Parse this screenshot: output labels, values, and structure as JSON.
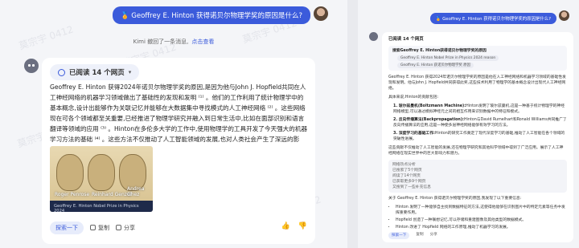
{
  "watermark": "莫宗宇 0412",
  "left": {
    "user_message": "🏅 Geoffrey E. Hinton 获得诺贝尔物理学奖的原因是什么?",
    "cancel_note": "Kimi 撤回了一条消息,",
    "cancel_link": "点击查看",
    "read_chip": "已阅读 14 个网页",
    "answer": "Geoffrey E. Hinton 获得2024年诺贝尔物理学奖的原因,是因为他与John J. Hopfield共同在人工神经网络的机器学习领域做出了基础性的发现和发明 ⁽¹⁾ 。他们的工作利用了统计物理学中的基本概念,设计出能够作为关联记忆并能够在大数据集中寻找模式的人工神经网络 ⁽²⁾ 。这些网络现在可各个领域都至关重要,已经推进了物理学研究并融入到日常生活中,比如在面部识别和语言翻译等领域的应用 ⁽³⁾ 。Hinton在多伦多大学的工作中,使用物理学的工具开发了今天强大的机器学习方法的基础 ⁽⁴⁾ 。这些方法不仅推动了人工智能领域的发展,也对人类社会产生了深远的影响。",
    "photo_names": [
      "Roger Penrose",
      "Reinhard Genzel",
      "Andrea Ghez"
    ],
    "photo_caption": "Geoffrey E. Hinton Nobel Prize in Physics 2024",
    "actions": {
      "search_more": "探索一下",
      "copy": "复制",
      "share": "分享"
    }
  },
  "right": {
    "user_message": "🏅 Geoffrey E. Hinton 获得诺贝尔物理学奖的原因是什么?",
    "read_title": "已阅读 14 个网页",
    "search_query": "搜索Geoffrey E. Hinton获得诺贝尔物理学奖的原因",
    "search_tags": [
      "Geoffrey E. Hinton Nobel Prize in Physics 2024 reason",
      "Geoffrey E. Hinton 获诺贝尔物理学奖 原因"
    ],
    "intro": "Geoffrey E. Hinton 获得2024年诺贝尔物理学奖的原因是他在人工神经网络和机器学习领域的基础性发现和发明。他与John J. Hopfield共同获得此奖,这些技术利用了物理学的基本概念设计出现代人工神经网络。",
    "contributions_title": "具体来说,Hinton的贡献包括:",
    "contributions": [
      {
        "name": "1. 玻尔兹曼机(Boltzmann Machine):",
        "text": "Hinton发明了玻尔兹曼机,这是一种基于统计物理学的神经网络模型,可以通过模拟神经元之间的相互作用来识别数据中的特征和模式。"
      },
      {
        "name": "2. 反向传播算法(Backpropagation):",
        "text": "Hinton与David Rumelhart和Ronald Williams共同推广了反向传播算法的应用,这是一种使多层神经网络能够有效学习的方法。"
      },
      {
        "name": "3. 深度学习的基础工作:",
        "text": "Hinton的研究工作奠定了现代深度学习的基础,推动了人工智能在各个领域的突破性进展。"
      }
    ],
    "impact": "这些贡献不仅推动了人工智能的发展,还在物理学研究和其他科学领域中得到了广泛应用。展示了人工神经网络在现实世界中的巨大影响力和潜力。",
    "read_box": [
      "网络热点分析",
      "已搜索了5个网页",
      "阅读了14个网页",
      "已获取更多9个网页",
      "又搜到了一些补充信息"
    ],
    "summary_title": "关于 Geoffrey E. Hinton 获得诺贝尔物理学奖的原因,我发现了以下重要信息:",
    "bullets": [
      "Hinton 发明了一种能够自主找到数据特征的方法,这使得他能够在识别图片中的特定元素等任务中发挥重要作用。",
      "Hopfield 创造了一种联想记忆,可以存储和重建图像及其他类型的数据模式。",
      "Hinton 改进了 Hopfield 网络的工作原理,推动了机器学习的发展。"
    ],
    "actions": {
      "search_more": "探索一下",
      "copy": "复制",
      "share": "分享"
    }
  }
}
